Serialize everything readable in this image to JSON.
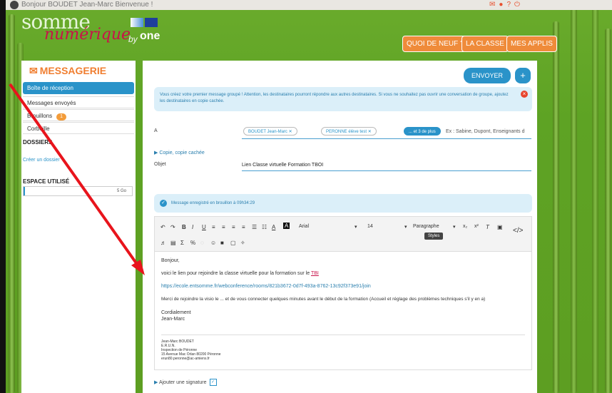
{
  "topbar": {
    "greeting": "Bonjour BOUDET Jean-Marc Bienvenue !"
  },
  "logo": {
    "line1": "somme",
    "line2": "numérique",
    "by": "by",
    "brand": "one"
  },
  "nav": {
    "quoi": "QUOI DE NEUF ?",
    "classe": "LA CLASSE",
    "applis": "MES APPLIS"
  },
  "sidebar": {
    "title": "MESSAGERIE",
    "items": [
      {
        "label": "Boîte de réception"
      },
      {
        "label": "Messages envoyés"
      },
      {
        "label": "Brouillons",
        "badge": "1"
      },
      {
        "label": "Corbeille"
      }
    ],
    "folders_heading": "DOSSIERS",
    "create_folder": "Créer un dossier",
    "space_heading": "ESPACE UTILISÉ",
    "space_value": "5 Go",
    "space_used_fraction": 0.01
  },
  "compose": {
    "send": "ENVOYER",
    "plus": "+",
    "alert": "Vous créez votre premier message groupé ! Attention, les destinataires pourront répondre aux autres destinataires. Si vous ne souhaitez pas ouvrir une conversation de groupe, ajoutez les destinataires en copie cachée.",
    "to_label": "A",
    "recipients": [
      "BOUDET Jean-Marc",
      "PERONNE élève test"
    ],
    "more": "... et 3 de plus",
    "to_placeholder": "Ex : Sabine, Dupont, Enseignants d",
    "copy": "Copie, copie cachée",
    "subject_label": "Objet",
    "subject": "Lien Classe virtuelle Formation TBOI",
    "saved": "Message enregistré en brouillon à 09h34:29"
  },
  "editor": {
    "font": "Arial",
    "size": "14",
    "paragraph": "Paragraphe",
    "styles_tip": "Styles",
    "greeting": "Bonjour,",
    "line1_pre": "voici le lien pour rejoindre la classe virtuelle pour la formation sur le ",
    "line1_tbi": "TBI",
    "link": "https://ecole.entsomme.fr/webconference/rooms/821b3672-0d7f-493a-8762-13c92f373e91/join",
    "line3": "Merci de rejoindre la visio le ... et de vous connecter quelques minutes avant le début de la formation (Accueil et réglage des problèmes techniques s'il y en a)",
    "closing1": "Cordialement",
    "closing2": "Jean-Marc",
    "sig": [
      "Jean-Marc BOUDET",
      "E.R.U.N.",
      "Inspection de Péronne",
      "15 Avenue Mac Orlan 80200 Péronne",
      "erun80.peronne@ac-amiens.fr"
    ]
  },
  "signature": {
    "label": "Ajouter une signature"
  }
}
